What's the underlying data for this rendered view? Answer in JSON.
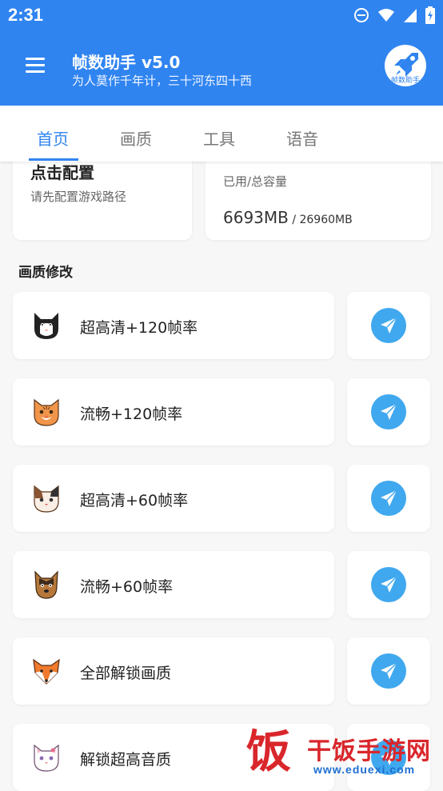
{
  "status_bar": {
    "time": "2:31"
  },
  "app_bar": {
    "title": "帧数助手 v5.0",
    "subtitle": "为人莫作千年计，三十河东四十西",
    "logo_text": "帧数助手"
  },
  "tabs": [
    {
      "label": "首页",
      "active": true
    },
    {
      "label": "画质",
      "active": false
    },
    {
      "label": "工具",
      "active": false
    },
    {
      "label": "语音",
      "active": false
    }
  ],
  "config_card": {
    "title": "点击配置",
    "subtitle": "请先配置游戏路径"
  },
  "storage_card": {
    "label": "已用/总容量",
    "used": "6693MB",
    "total": " / 26960MB"
  },
  "section": {
    "title": "画质修改"
  },
  "options": [
    {
      "label": "超高清+120帧率",
      "icon": "black-white-cat-icon"
    },
    {
      "label": "流畅+120帧率",
      "icon": "orange-cat-icon"
    },
    {
      "label": "超高清+60帧率",
      "icon": "calico-cat-icon"
    },
    {
      "label": "流畅+60帧率",
      "icon": "dog-icon"
    },
    {
      "label": "全部解锁画质",
      "icon": "fox-icon"
    },
    {
      "label": "解锁超高音质",
      "icon": "white-cat-icon"
    }
  ],
  "colors": {
    "primary": "#2f84f0",
    "action": "#40a8ee",
    "background": "#f7f7f7",
    "watermark": "#d9262b"
  },
  "watermark": {
    "big": "饭",
    "name": "干饭手游网",
    "url": "www.eduexi.com"
  }
}
